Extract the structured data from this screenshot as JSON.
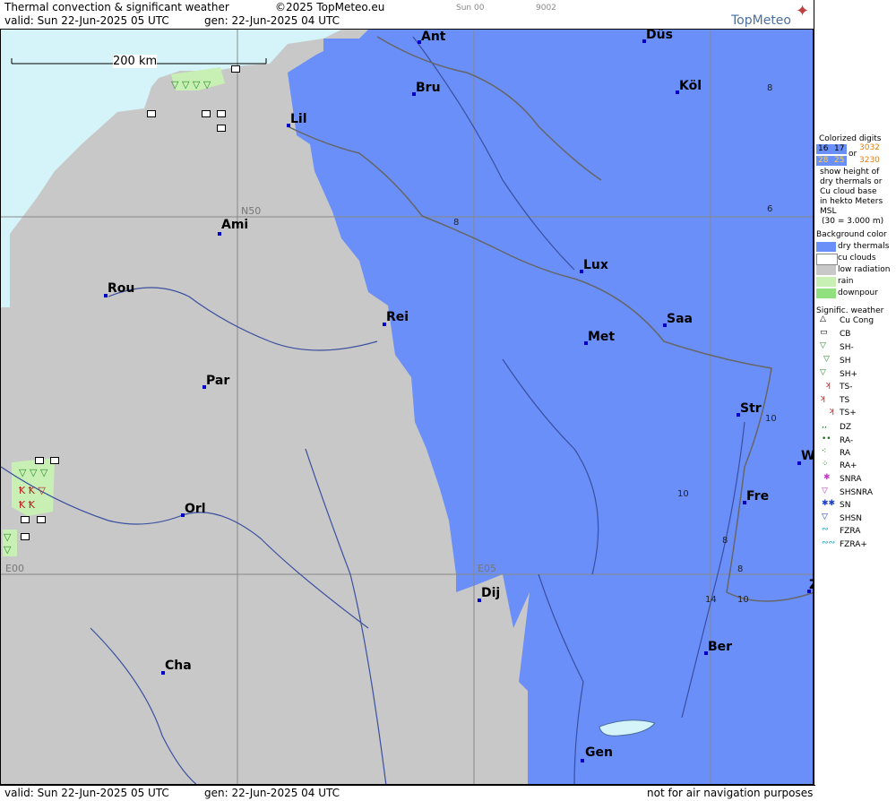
{
  "header": {
    "title": "Thermal convection & significant weather",
    "copyright": "©2025 TopMeteo.eu",
    "valid": "valid:  Sun  22-Jun-2025  05 UTC",
    "gen": "gen: 22-Jun-2025 04 UTC",
    "small1": "Sun 00",
    "small2": "9002",
    "brand": "TopMeteo"
  },
  "footer": {
    "valid": "valid:  Sun  22-Jun-2025  05 UTC",
    "gen": "gen: 22-Jun-2025 04 UTC",
    "disclaimer": "not for air navigation purposes"
  },
  "map": {
    "scale_label": "200 km",
    "grid_labels": [
      "N50",
      "E00",
      "E05"
    ],
    "cities": [
      "Ant",
      "Düs",
      "Bru",
      "Köl",
      "Lil",
      "Ami",
      "Rou",
      "Rei",
      "Lux",
      "Saa",
      "Met",
      "Par",
      "Str",
      "W",
      "Fre",
      "Orl",
      "Dij",
      "Ber",
      "Cha",
      "Gen",
      "Z"
    ],
    "numbers": [
      "8",
      "8",
      "6",
      "10",
      "10",
      "8",
      "8",
      "14",
      "10"
    ]
  },
  "legend": {
    "colorized_title": "Colorized digits",
    "digits_a1": "16",
    "digits_a2": "17",
    "digits_b1": "28",
    "digits_b2": "25",
    "or": "or",
    "digits_c": "3032",
    "digits_d": "3230",
    "desc1": "show height of",
    "desc2": "dry thermals or",
    "desc3": "Cu cloud base",
    "desc4": "in hekto Meters",
    "desc5": "MSL",
    "desc6": "(30 = 3.000 m)",
    "bg_title": "Background color",
    "bg_items": [
      "dry thermals",
      "cu clouds",
      "low radiation",
      "rain",
      "downpour"
    ],
    "wx_title": "Signific. weather",
    "wx_items": [
      "Cu Cong",
      "CB",
      "SH-",
      "SH",
      "SH+",
      "TS-",
      "TS",
      "TS+",
      "DZ",
      "RA-",
      "RA",
      "RA+",
      "SNRA",
      "SHSNRA",
      "SN",
      "SHSN",
      "FZRA",
      "FZRA+"
    ],
    "colors": {
      "dry": "#6a8ff8",
      "cu": "#ffffff",
      "low": "#c8c8c8",
      "rain": "#c8f0b4",
      "downpour": "#90e080",
      "sea": "#d4f4fa"
    }
  }
}
